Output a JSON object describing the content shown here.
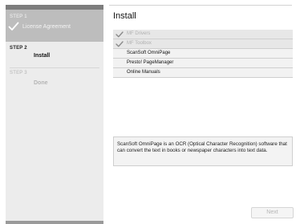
{
  "sidebar": {
    "steps": [
      {
        "number": "STEP 1",
        "label": "License Agreement",
        "state": "completed"
      },
      {
        "number": "STEP 2",
        "label": "Install",
        "state": "current"
      },
      {
        "number": "STEP 3",
        "label": "Done",
        "state": "upcoming"
      }
    ]
  },
  "main": {
    "title": "Install",
    "components": [
      {
        "label": "MF Drivers",
        "installed": true
      },
      {
        "label": "MF Toolbox",
        "installed": true
      },
      {
        "label": "ScanSoft OmniPage",
        "installed": false
      },
      {
        "label": "Presto! PageManager",
        "installed": false
      },
      {
        "label": "Online Manuals",
        "installed": false
      }
    ],
    "description": "ScanSoft OmniPage is an OCR (Optical Character Recognition) software that can convert the text in books or newspaper characters into text data."
  },
  "footer": {
    "next_label": "Next"
  },
  "colors": {
    "sidebar_bg": "#ececec",
    "completed_step_bg": "#bdbdbd",
    "disabled_text": "#b4b4b4"
  }
}
